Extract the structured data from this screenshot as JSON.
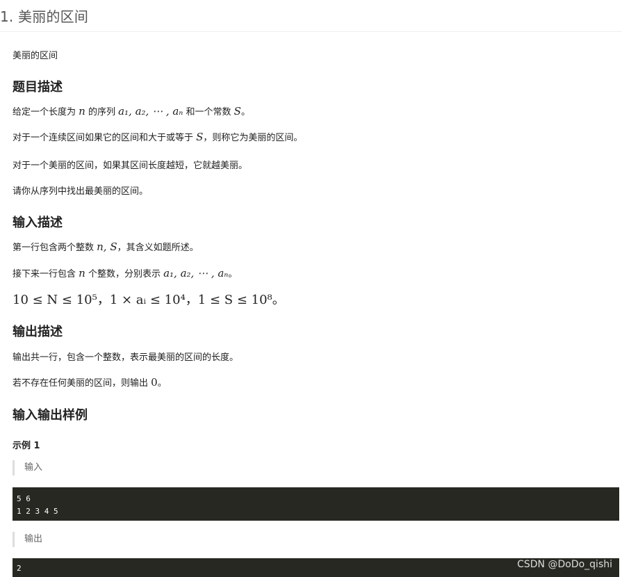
{
  "header": {
    "title": "1. 美丽的区间"
  },
  "intro": "美丽的区间",
  "sections": {
    "desc_title": "题目描述",
    "input_title": "输入描述",
    "output_title": "输出描述",
    "examples_title": "输入输出样例"
  },
  "desc": {
    "l1_a": "给定一个长度为 ",
    "l1_n": "n",
    "l1_b": " 的序列 ",
    "l1_seq": "a₁, a₂, ⋯ , aₙ",
    "l1_c": " 和一个常数 ",
    "l1_S": "S",
    "l1_d": "。",
    "l2_a": "对于一个连续区间如果它的区间和大于或等于 ",
    "l2_S": "S",
    "l2_b": "，则称它为美丽的区间。",
    "l3": "对于一个美丽的区间，如果其区间长度越短，它就越美丽。",
    "l4": "请你从序列中找出最美丽的区间。"
  },
  "input": {
    "l1_a": "第一行包含两个整数 ",
    "l1_nS": "n, S",
    "l1_b": "，其含义如题所述。",
    "l2_a": "接下来一行包含 ",
    "l2_n": "n",
    "l2_b": " 个整数，分别表示 ",
    "l2_seq": "a₁, a₂, ⋯ , aₙ",
    "l2_c": "。",
    "constraints": "10 ≤ N ≤ 10⁵，1 × aᵢ ≤ 10⁴，1 ≤ S ≤ 10⁸。"
  },
  "output": {
    "l1": "输出共一行，包含一个整数，表示最美丽的区间的长度。",
    "l2_a": "若不存在任何美丽的区间，则输出 ",
    "l2_zero": "0",
    "l2_b": "。"
  },
  "example": {
    "title": "示例 1",
    "input_label": "输入",
    "input_code": "5 6\n1 2 3 4 5",
    "output_label": "输出",
    "output_code": "2"
  },
  "watermark": "CSDN @DoDo_qishi"
}
